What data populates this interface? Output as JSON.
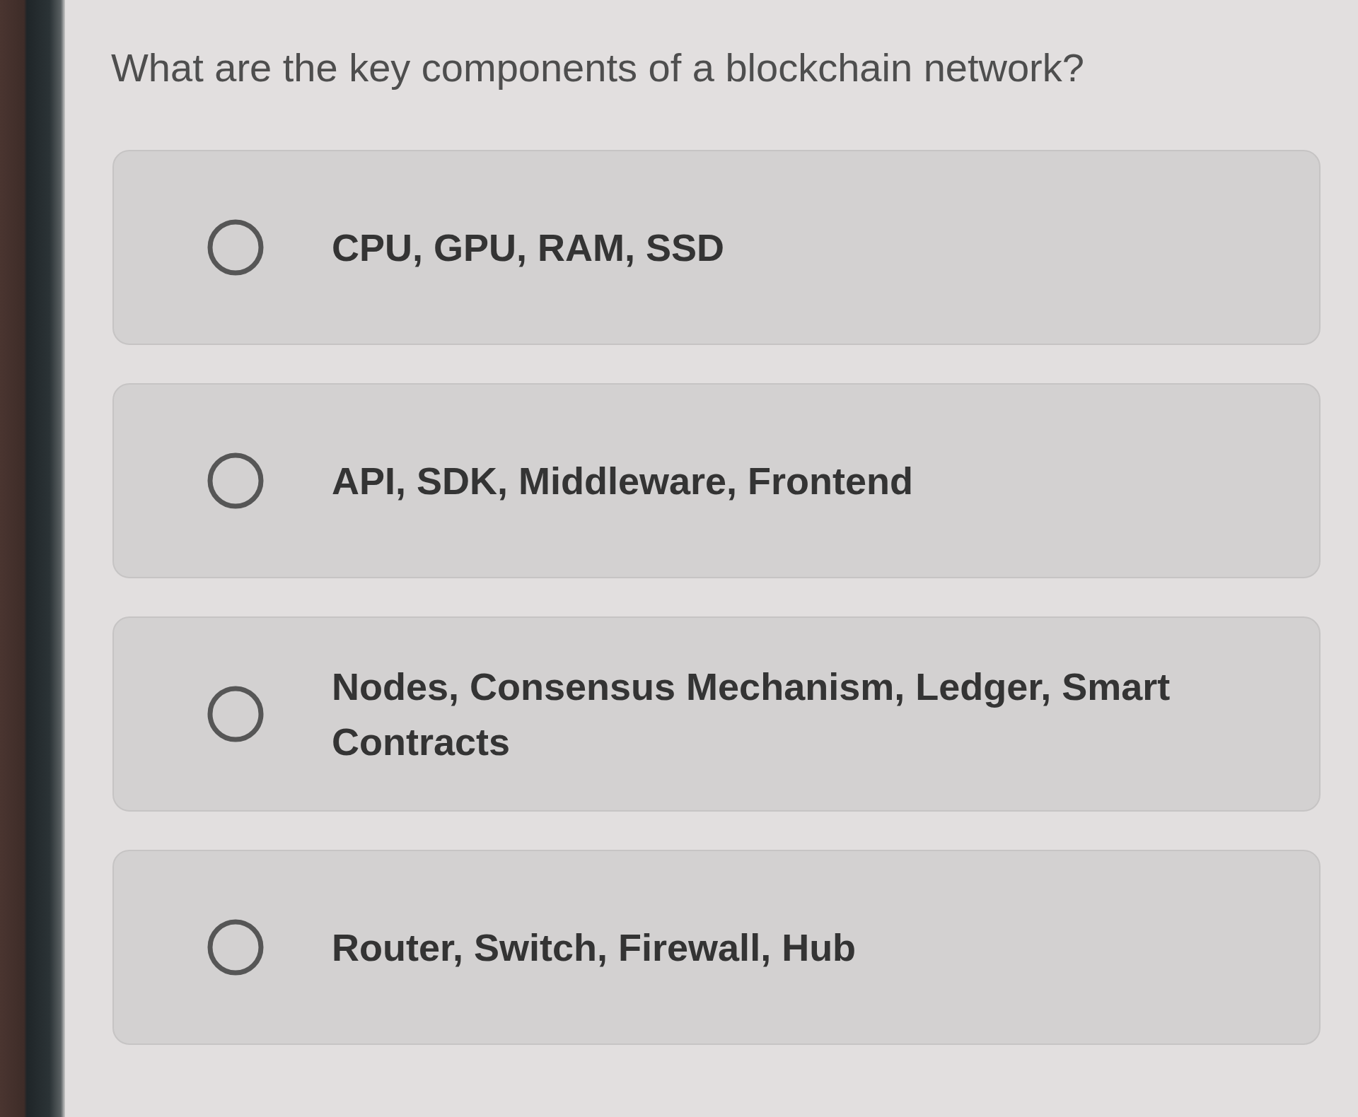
{
  "question": {
    "text": "What are the key components of a blockchain network?"
  },
  "options": [
    {
      "label": "CPU, GPU, RAM, SSD",
      "selected": false
    },
    {
      "label": "API, SDK, Middleware, Frontend",
      "selected": false
    },
    {
      "label": "Nodes, Consensus Mechanism, Ledger, Smart Contracts",
      "selected": false
    },
    {
      "label": "Router, Switch, Firewall, Hub",
      "selected": false
    }
  ]
}
